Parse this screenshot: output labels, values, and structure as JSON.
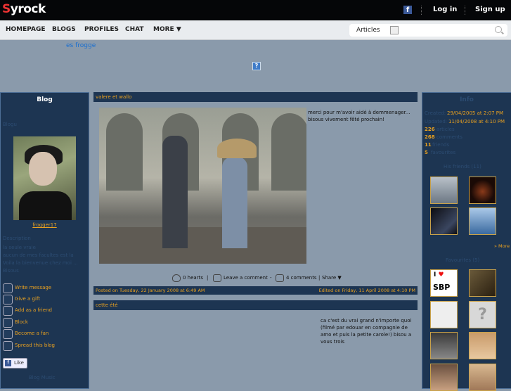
{
  "brand": {
    "name_prefix": "S",
    "name_suffix": "yrock"
  },
  "top": {
    "facebook_icon": "f",
    "login": "Log in",
    "signup": "Sign up"
  },
  "nav": {
    "items": [
      "HOMEPAGE",
      "BLOGS",
      "PROFILES",
      "CHAT",
      "MORE ▼"
    ]
  },
  "search": {
    "category": "Articles",
    "placeholder": ""
  },
  "blog_link": "es frogge",
  "ad_icon": "?",
  "left": {
    "title": "Blog",
    "blog_label": "Blogu",
    "username": "frogger17",
    "desc_label": "Description",
    "desc_lines": [
      "la seule vraie",
      "aucun de mes facultes est la",
      "Voila la bienvenue chez moi ...",
      "Bisous"
    ],
    "actions": [
      "Write message",
      "Give a gift",
      "Add as a friend",
      "Block",
      "Become a fan",
      "Spread this blog"
    ],
    "like": "Like",
    "footer_title": "Blog Music"
  },
  "post1": {
    "title": "valere et wallo",
    "text_lines": [
      "merci pour m'avoir aidé à demmenager...",
      "bisous vivement fêté prochain!"
    ],
    "hearts": "0 hearts",
    "leave_comment": "Leave a comment",
    "comments": "4 comments",
    "share": "Share ▼",
    "posted": "Posted on Tuesday, 22 January 2008 at 6:49 AM",
    "edited": "Edited on Friday, 11 April 2008 at 4:10 PM"
  },
  "post2": {
    "title": "cette été",
    "text_lines": [
      "ca c'est du vrai grand n'importe quoi",
      "(filmé par edouar en compagnie de",
      "amo et puis la petite carole!) bisou a",
      "vous trois"
    ]
  },
  "right": {
    "title": "Info",
    "created_label": "Created:",
    "created": "29/04/2005 at 2:07 PM",
    "updated_label": "Updated:",
    "updated": "11/04/2008 at 4:10 PM",
    "stats": [
      {
        "n": "226",
        "label": "articles"
      },
      {
        "n": "268",
        "label": "comments"
      },
      {
        "n": "11",
        "label": "friends"
      },
      {
        "n": "5",
        "label": "favourites"
      }
    ],
    "friends_title": "His friends (11)",
    "more": "» More",
    "favs_title": "Favourites (5)",
    "sbp_text": "SBP"
  }
}
